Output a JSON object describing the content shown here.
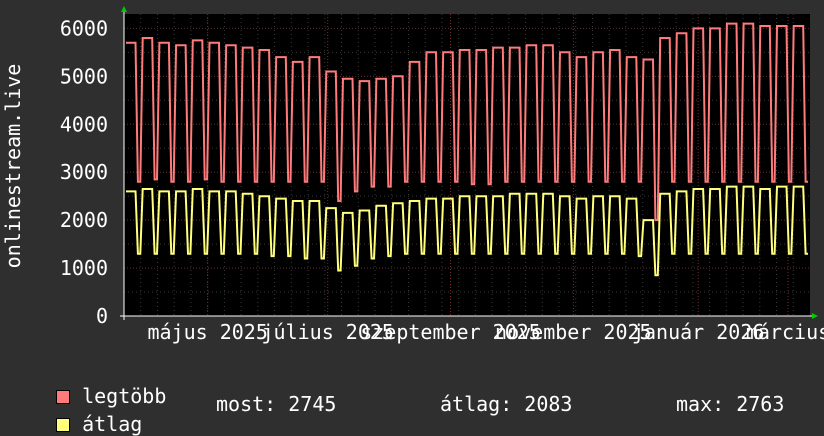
{
  "chart_data": {
    "type": "line",
    "ylabel": "onlinestream.live",
    "ylim": [
      0,
      6300
    ],
    "yticks": [
      0,
      1000,
      2000,
      3000,
      4000,
      5000,
      6000
    ],
    "x_tick_labels": [
      "május 2025",
      "július 2025",
      "szeptember 2025",
      "november 2025",
      "január 2026",
      "március"
    ],
    "grid": true,
    "series": [
      {
        "name": "legtöbb",
        "color": "#ff7b7b",
        "weekly_high": [
          5700,
          5800,
          5700,
          5650,
          5750,
          5700,
          5650,
          5600,
          5550,
          5400,
          5300,
          5400,
          5100,
          4950,
          4900,
          4950,
          5000,
          5300,
          5500,
          5500,
          5550,
          5550,
          5600,
          5600,
          5650,
          5650,
          5500,
          5400,
          5500,
          5550,
          5400,
          5350,
          5800,
          5900,
          6000,
          6000,
          6100,
          6100,
          6050,
          6050,
          6050
        ],
        "weekly_low": [
          2800,
          2850,
          2800,
          2800,
          2850,
          2800,
          2800,
          2800,
          2800,
          2800,
          2800,
          2800,
          2400,
          2600,
          2700,
          2700,
          2800,
          2800,
          2800,
          2800,
          2750,
          2750,
          2800,
          2800,
          2800,
          2800,
          2800,
          2800,
          2800,
          2800,
          2800,
          2000,
          2800,
          2800,
          2800,
          2800,
          2800,
          2800,
          2800,
          2800,
          2800
        ]
      },
      {
        "name": "átlag",
        "color": "#ffff7b",
        "weekly_high": [
          2600,
          2650,
          2600,
          2600,
          2650,
          2600,
          2600,
          2550,
          2500,
          2450,
          2400,
          2400,
          2250,
          2150,
          2200,
          2300,
          2350,
          2400,
          2450,
          2450,
          2500,
          2500,
          2500,
          2550,
          2550,
          2550,
          2500,
          2450,
          2500,
          2500,
          2450,
          2000,
          2550,
          2600,
          2650,
          2650,
          2700,
          2700,
          2650,
          2700,
          2700
        ],
        "weekly_low": [
          1300,
          1300,
          1300,
          1300,
          1300,
          1300,
          1300,
          1300,
          1250,
          1250,
          1200,
          1200,
          950,
          1050,
          1200,
          1250,
          1300,
          1300,
          1300,
          1300,
          1300,
          1300,
          1300,
          1300,
          1300,
          1300,
          1300,
          1300,
          1300,
          1300,
          1250,
          850,
          1300,
          1300,
          1300,
          1300,
          1300,
          1300,
          1300,
          1300,
          1300
        ]
      }
    ]
  },
  "legend": {
    "max_label": "legtöbb",
    "avg_label": "átlag",
    "now": "most: 2745",
    "average": "átlag: 2083",
    "maximum": "max: 2763"
  }
}
